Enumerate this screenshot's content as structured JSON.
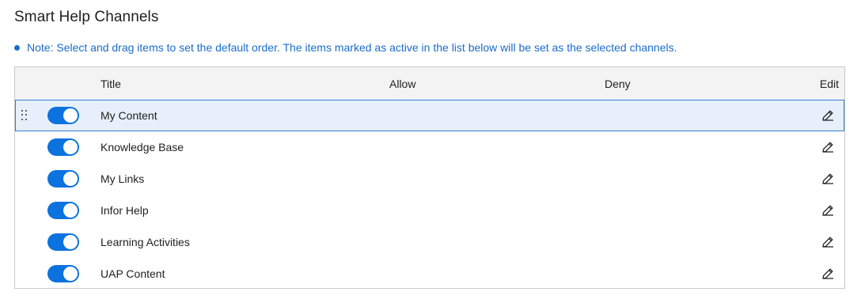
{
  "page": {
    "title": "Smart Help Channels",
    "note": "Note: Select and drag items to set the default order. The items marked as active in the list below will be set as the selected channels."
  },
  "table": {
    "headers": {
      "title": "Title",
      "allow": "Allow",
      "deny": "Deny",
      "edit": "Edit"
    },
    "rows": [
      {
        "title": "My Content",
        "active": true,
        "selected": true
      },
      {
        "title": "Knowledge Base",
        "active": true,
        "selected": false
      },
      {
        "title": "My Links",
        "active": true,
        "selected": false
      },
      {
        "title": "Infor Help",
        "active": true,
        "selected": false
      },
      {
        "title": "Learning Activities",
        "active": true,
        "selected": false
      },
      {
        "title": "UAP Content",
        "active": true,
        "selected": false
      }
    ]
  },
  "icons": {
    "drag": "drag-handle-icon",
    "edit": "pencil-icon",
    "note": "bullet-icon"
  },
  "colors": {
    "accent": "#0b72de",
    "note": "#1a6dc9",
    "selected_row": "#e7f0fa",
    "header_bg": "#f3f3f3"
  }
}
